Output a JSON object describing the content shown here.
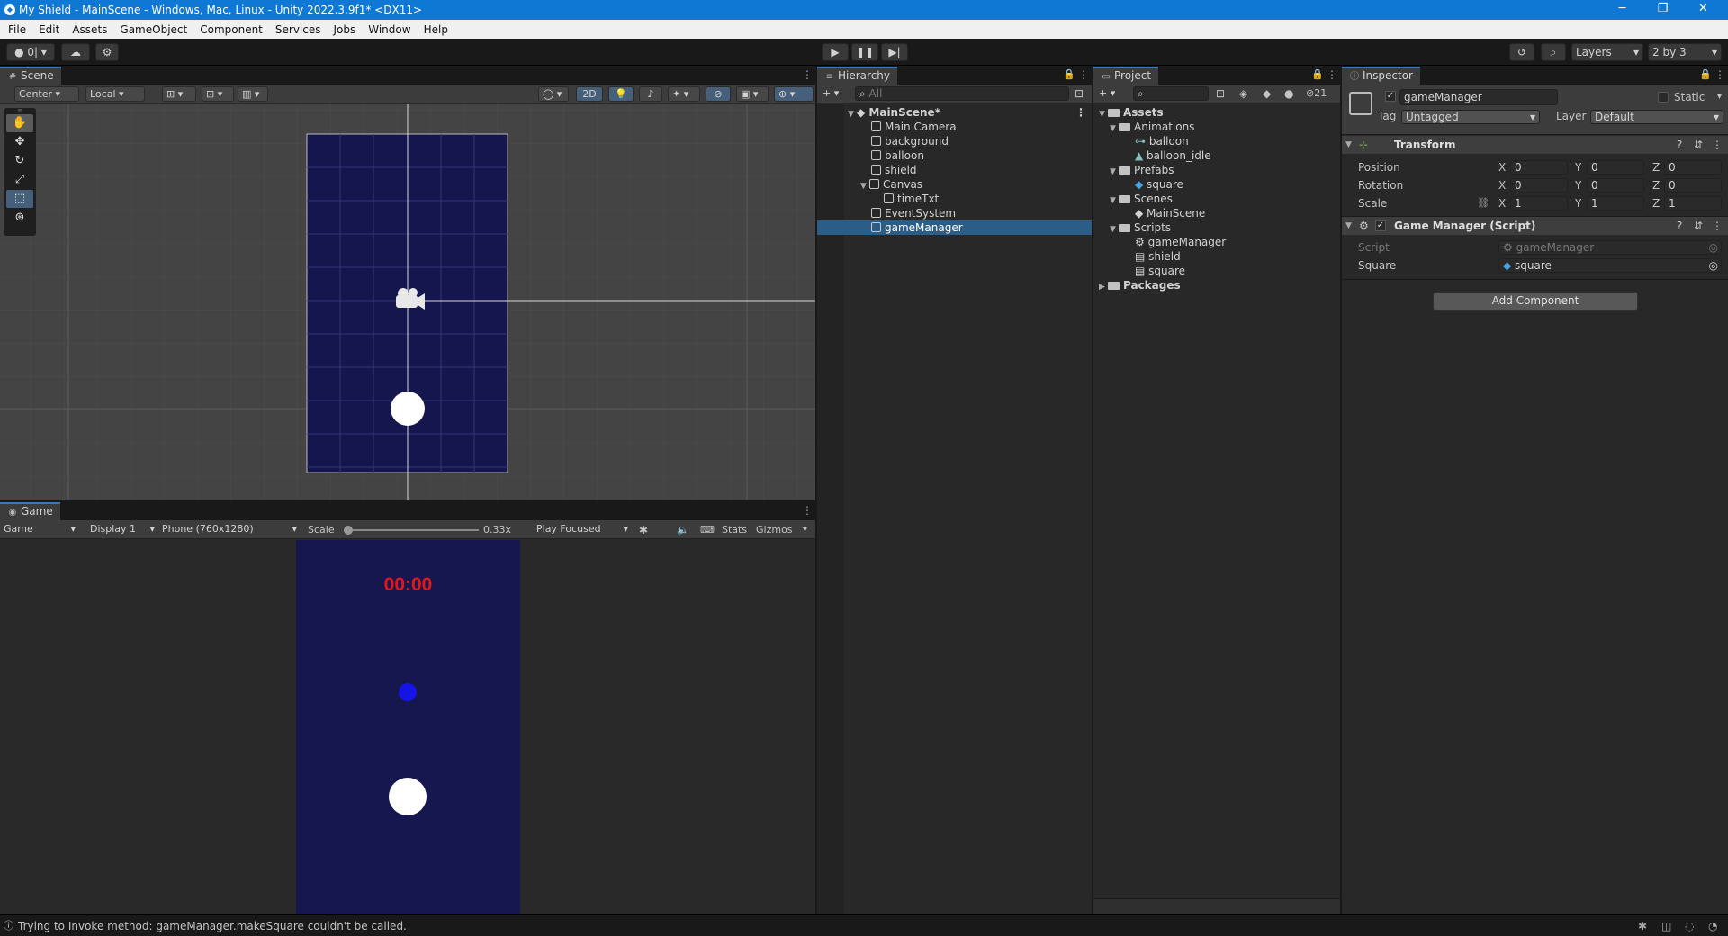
{
  "window": {
    "title": "My Shield - MainScene - Windows, Mac, Linux - Unity 2022.3.9f1* <DX11>",
    "controls": [
      "─",
      "❐",
      "✕"
    ]
  },
  "menu": [
    "File",
    "Edit",
    "Assets",
    "GameObject",
    "Component",
    "Services",
    "Jobs",
    "Window",
    "Help"
  ],
  "toolbar": {
    "account": "0|",
    "layers": "Layers",
    "layout": "2 by 3"
  },
  "scene": {
    "tab": "Scene",
    "pivot": "Center",
    "space": "Local",
    "mode_2d": "2D"
  },
  "game": {
    "tab": "Game",
    "view": "Game",
    "display": "Display 1",
    "resolution": "Phone (760x1280)",
    "scale_label": "Scale",
    "scale_value": "0.33x",
    "play_mode": "Play Focused",
    "stats": "Stats",
    "gizmos": "Gizmos",
    "timer": "00:00"
  },
  "hierarchy": {
    "tab": "Hierarchy",
    "search_placeholder": "All",
    "scene": "MainScene*",
    "items": [
      "Main Camera",
      "background",
      "balloon",
      "shield",
      "Canvas",
      "timeTxt",
      "EventSystem",
      "gameManager"
    ]
  },
  "project": {
    "tab": "Project",
    "hidden_count": "21",
    "tree": {
      "assets": "Assets",
      "animations": "Animations",
      "anim_items": [
        "balloon",
        "balloon_idle"
      ],
      "prefabs": "Prefabs",
      "prefab_items": [
        "square"
      ],
      "scenes": "Scenes",
      "scene_items": [
        "MainScene"
      ],
      "scripts": "Scripts",
      "script_items": [
        "gameManager",
        "shield",
        "square"
      ],
      "packages": "Packages"
    }
  },
  "inspector": {
    "tab": "Inspector",
    "object_name": "gameManager",
    "static_label": "Static",
    "tag_label": "Tag",
    "tag_value": "Untagged",
    "layer_label": "Layer",
    "layer_value": "Default",
    "transform": {
      "title": "Transform",
      "position_label": "Position",
      "rotation_label": "Rotation",
      "scale_label": "Scale",
      "position": [
        "0",
        "0",
        "0"
      ],
      "rotation": [
        "0",
        "0",
        "0"
      ],
      "scale": [
        "1",
        "1",
        "1"
      ],
      "axes": [
        "X",
        "Y",
        "Z"
      ]
    },
    "script_component": {
      "title": "Game Manager (Script)",
      "script_label": "Script",
      "script_value": "gameManager",
      "square_label": "Square",
      "square_value": "square"
    },
    "add_component": "Add Component"
  },
  "status": {
    "message": "Trying to Invoke method: gameManager.makeSquare couldn't be called."
  },
  "colors": {
    "titlebar": "#0f78d4",
    "game_bg": "#17174f",
    "timer": "#e01818",
    "shield_dot": "#1414e6",
    "selection": "#2c5d87"
  }
}
